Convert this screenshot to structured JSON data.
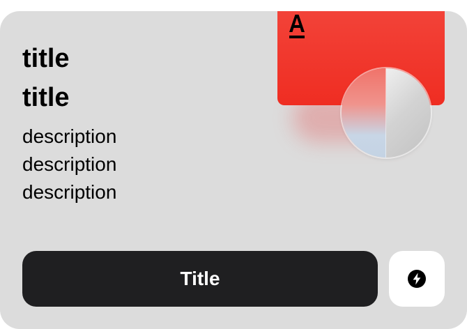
{
  "card": {
    "title_lines": [
      "title",
      "title"
    ],
    "description_lines": [
      "description",
      "description",
      "description"
    ],
    "button_label": "Title",
    "icon_button": {
      "icon": "lightning-bolt-icon"
    },
    "promo_card": {
      "logo": "alfa-bank-logo",
      "color": "#EF3124"
    }
  },
  "colors": {
    "card_background": "#DCDCDC",
    "button_background": "#1F1F21",
    "icon_button_background": "#FFFFFF"
  }
}
